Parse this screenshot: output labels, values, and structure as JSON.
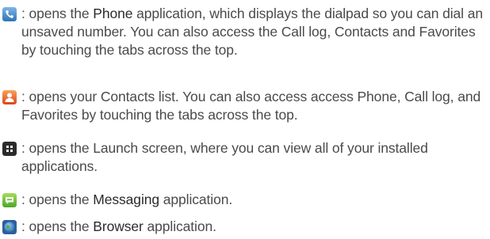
{
  "items": [
    {
      "icon": "phone-icon",
      "prefix": ": opens the ",
      "keyword": "Phone",
      "suffix": " application, which displays the dialpad so you can dial an unsaved number. You can also access the Call log, Contacts and Favorites by touching the tabs across the top."
    },
    {
      "icon": "contacts-icon",
      "text": ": opens your Contacts list. You can also access access Phone, Call log, and Favorites by touching the tabs across the top."
    },
    {
      "icon": "launcher-icon",
      "text": ": opens the Launch screen, where you can view all of your installed applications."
    },
    {
      "icon": "messaging-icon",
      "prefix": ": opens the ",
      "keyword": "Messaging",
      "suffix": " application."
    },
    {
      "icon": "browser-icon",
      "prefix": ": opens the ",
      "keyword": "Browser",
      "suffix": " application."
    }
  ]
}
